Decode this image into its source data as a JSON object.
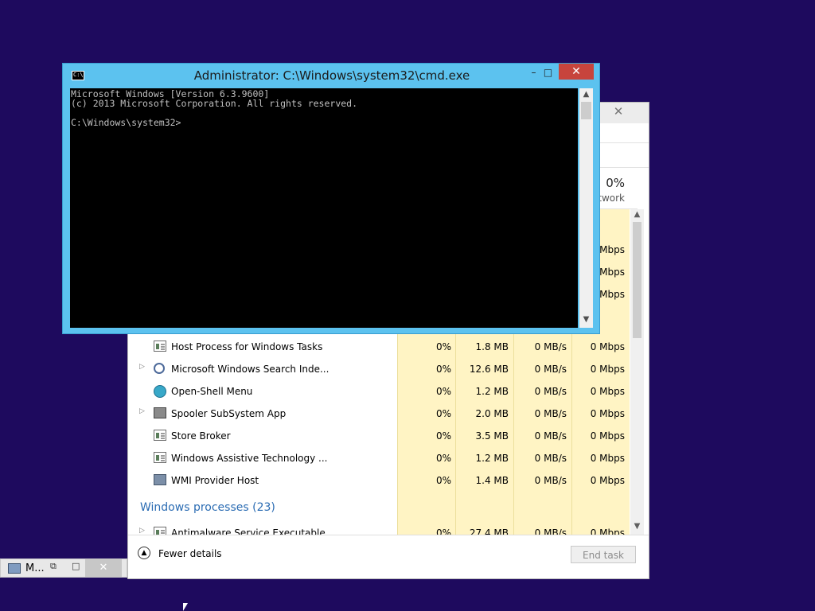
{
  "cmd": {
    "title": "Administrator: C:\\Windows\\system32\\cmd.exe",
    "icon_text": "C:\\",
    "minimize_label": "–",
    "maximize_label": "□",
    "close_label": "✕",
    "lines": [
      "Microsoft Windows [Version 6.3.9600]",
      "(c) 2013 Microsoft Corporation. All rights reserved.",
      "",
      "C:\\Windows\\system32>"
    ]
  },
  "task_manager": {
    "close_label": "✕",
    "network_header": {
      "percent": "0%",
      "label": "twork"
    },
    "partial_network_values": [
      "Mbps",
      "Mbps",
      "Mbps"
    ],
    "rows": [
      {
        "name": "Host Process for Windows Tasks",
        "icon": "app-icon",
        "expandable": false,
        "cpu": "0%",
        "memory": "1.8 MB",
        "disk": "0 MB/s",
        "network": "0 Mbps"
      },
      {
        "name": "Microsoft Windows Search Inde...",
        "icon": "search-icon",
        "expandable": true,
        "cpu": "0%",
        "memory": "12.6 MB",
        "disk": "0 MB/s",
        "network": "0 Mbps"
      },
      {
        "name": "Open-Shell Menu",
        "icon": "shell-icon",
        "expandable": false,
        "cpu": "0%",
        "memory": "1.2 MB",
        "disk": "0 MB/s",
        "network": "0 Mbps"
      },
      {
        "name": "Spooler SubSystem App",
        "icon": "printer-icon",
        "expandable": true,
        "cpu": "0%",
        "memory": "2.0 MB",
        "disk": "0 MB/s",
        "network": "0 Mbps"
      },
      {
        "name": "Store Broker",
        "icon": "app-icon",
        "expandable": false,
        "cpu": "0%",
        "memory": "3.5 MB",
        "disk": "0 MB/s",
        "network": "0 Mbps"
      },
      {
        "name": "Windows Assistive Technology ...",
        "icon": "app-icon",
        "expandable": false,
        "cpu": "0%",
        "memory": "1.2 MB",
        "disk": "0 MB/s",
        "network": "0 Mbps"
      },
      {
        "name": "WMI Provider Host",
        "icon": "wmi-icon",
        "expandable": false,
        "cpu": "0%",
        "memory": "1.4 MB",
        "disk": "0 MB/s",
        "network": "0 Mbps"
      }
    ],
    "group": "Windows processes (23)",
    "partial_row": {
      "name": "Antimalware Service Executable",
      "cpu": "0%",
      "memory": "27.4 MB",
      "disk": "0 MB/s",
      "network": "0 Mbps"
    },
    "fewer_details": "Fewer details",
    "end_task": "End task"
  },
  "minimized_window": {
    "label": "M...",
    "restore_label": "⧉",
    "maximize_label": "□",
    "close_label": "✕"
  },
  "colors": {
    "desktop": "#1e0a5e",
    "cmd_frame": "#5cc2ef",
    "close_red": "#c7443c",
    "heat_yellow": "#fff4c4",
    "group_blue": "#2b6cb3"
  }
}
